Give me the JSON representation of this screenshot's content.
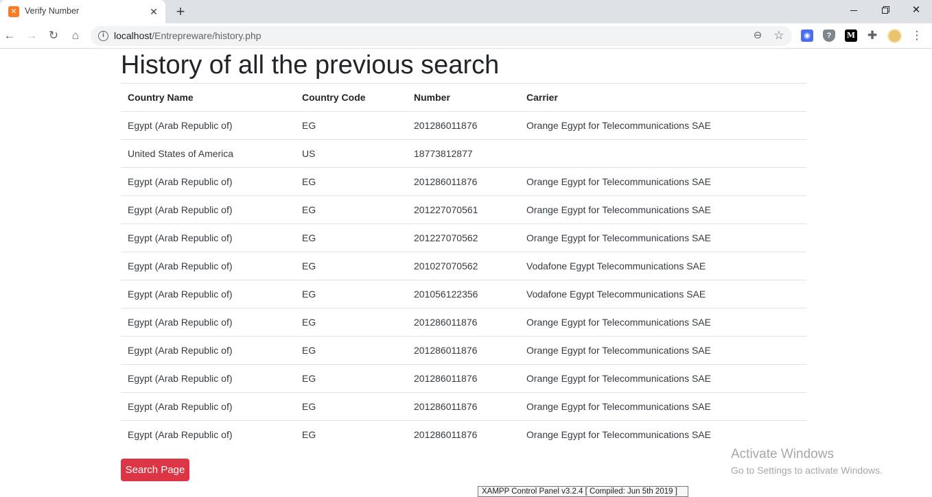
{
  "browser": {
    "tab_title": "Verify Number",
    "tab_favicon": "xampp-icon",
    "url_host": "localhost",
    "url_path": "/Entrepreware/history.php"
  },
  "page": {
    "title": "History of all the previous search",
    "columns": [
      "Country Name",
      "Country Code",
      "Number",
      "Carrier"
    ],
    "rows": [
      [
        "Egypt (Arab Republic of)",
        "EG",
        "201286011876",
        "Orange Egypt for Telecommunications SAE"
      ],
      [
        "United States of America",
        "US",
        "18773812877",
        ""
      ],
      [
        "Egypt (Arab Republic of)",
        "EG",
        "201286011876",
        "Orange Egypt for Telecommunications SAE"
      ],
      [
        "Egypt (Arab Republic of)",
        "EG",
        "201227070561",
        "Orange Egypt for Telecommunications SAE"
      ],
      [
        "Egypt (Arab Republic of)",
        "EG",
        "201227070562",
        "Orange Egypt for Telecommunications SAE"
      ],
      [
        "Egypt (Arab Republic of)",
        "EG",
        "201027070562",
        "Vodafone Egypt Telecommunications SAE"
      ],
      [
        "Egypt (Arab Republic of)",
        "EG",
        "201056122356",
        "Vodafone Egypt Telecommunications SAE"
      ],
      [
        "Egypt (Arab Republic of)",
        "EG",
        "201286011876",
        "Orange Egypt for Telecommunications SAE"
      ],
      [
        "Egypt (Arab Republic of)",
        "EG",
        "201286011876",
        "Orange Egypt for Telecommunications SAE"
      ],
      [
        "Egypt (Arab Republic of)",
        "EG",
        "201286011876",
        "Orange Egypt for Telecommunications SAE"
      ],
      [
        "Egypt (Arab Republic of)",
        "EG",
        "201286011876",
        "Orange Egypt for Telecommunications SAE"
      ],
      [
        "Egypt (Arab Republic of)",
        "EG",
        "201286011876",
        "Orange Egypt for Telecommunications SAE"
      ]
    ],
    "search_button_label": "Search Page",
    "search_button_color": "#dc3545"
  },
  "windows_watermark": {
    "title": "Activate Windows",
    "subtitle": "Go to Settings to activate Windows."
  },
  "xampp_tooltip": "XAMPP Control Panel v3.2.4   [ Compiled: Jun 5th 2019 ]"
}
